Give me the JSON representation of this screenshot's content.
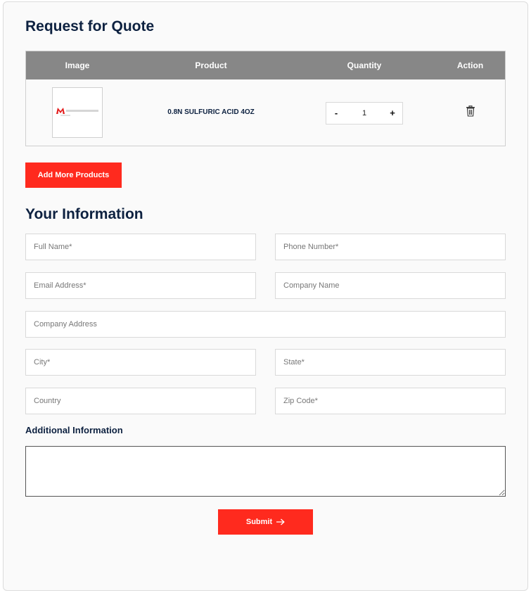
{
  "page": {
    "title": "Request for Quote",
    "info_heading": "Your Information",
    "additional_heading": "Additional Information"
  },
  "table": {
    "headers": [
      "Image",
      "Product",
      "Quantity",
      "Action"
    ],
    "rows": [
      {
        "product": "0.8N SULFURIC ACID 4OZ",
        "quantity": "1",
        "minus": "-",
        "plus": "+"
      }
    ]
  },
  "buttons": {
    "add_more": "Add More Products",
    "submit": "Submit"
  },
  "form": {
    "full_name": "Full Name*",
    "phone": "Phone Number*",
    "email": "Email Address*",
    "company_name": "Company Name",
    "company_address": "Company Address",
    "city": "City*",
    "state": "State*",
    "country": "Country",
    "zip": "Zip Code*"
  },
  "colors": {
    "accent": "#ff2a1e",
    "heading": "#0d2140",
    "table_header": "#878787"
  },
  "icons": {
    "delete": "trash-icon",
    "submit_arrow": "arrow-right-icon"
  }
}
